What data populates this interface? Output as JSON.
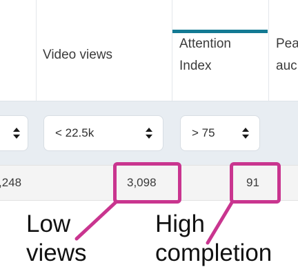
{
  "table": {
    "columns": [
      {
        "line1": "",
        "line2": ""
      },
      {
        "line1": "Video views",
        "line2": ""
      },
      {
        "line1": "Attention",
        "line2": "Index"
      },
      {
        "line1": "Pea",
        "line2": "auc"
      }
    ],
    "filters": [
      {
        "value": ""
      },
      {
        "value": "< 22.5k"
      },
      {
        "value": "> 75"
      }
    ],
    "row": {
      "cells": [
        ",248",
        "3,098",
        "91",
        ""
      ]
    },
    "active_column": "Attention Index"
  },
  "annotations": {
    "left": {
      "line1": "Low",
      "line2": "views"
    },
    "right": {
      "line1": "High",
      "line2": "completion"
    }
  },
  "colors": {
    "accent_bar": "#137a93",
    "highlight": "#c9358f",
    "filter_row_bg": "#e8edf2"
  }
}
